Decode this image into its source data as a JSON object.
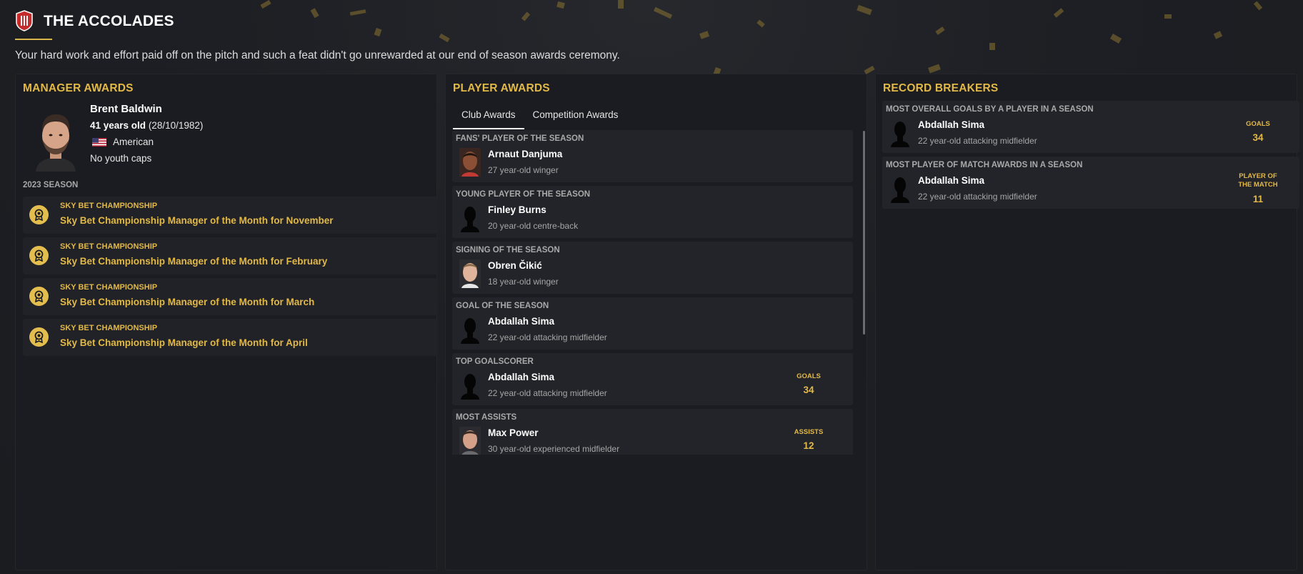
{
  "header": {
    "title": "THE ACCOLADES",
    "subtitle": "Your hard work and effort paid off on the pitch and such a feat didn't go unrewarded at our end of season awards ceremony."
  },
  "colors": {
    "accent": "#e2b847",
    "background": "#1c1e23",
    "card": "#22242a"
  },
  "manager_awards": {
    "title": "MANAGER AWARDS",
    "manager": {
      "name": "Brent Baldwin",
      "age_text": "41 years old",
      "dob": "(28/10/1982)",
      "nationality": "American",
      "youth_caps": "No youth caps",
      "flag_icon": "us-flag-icon"
    },
    "season_label": "2023 SEASON",
    "awards": [
      {
        "competition": "SKY BET CHAMPIONSHIP",
        "name": "Sky Bet Championship Manager of the Month for November",
        "icon": "award-medal-icon"
      },
      {
        "competition": "SKY BET CHAMPIONSHIP",
        "name": "Sky Bet Championship Manager of the Month for February",
        "icon": "award-medal-icon"
      },
      {
        "competition": "SKY BET CHAMPIONSHIP",
        "name": "Sky Bet Championship Manager of the Month for March",
        "icon": "award-medal-icon"
      },
      {
        "competition": "SKY BET CHAMPIONSHIP",
        "name": "Sky Bet Championship Manager of the Month for April",
        "icon": "award-medal-icon"
      }
    ]
  },
  "player_awards": {
    "title": "PLAYER AWARDS",
    "tabs": [
      {
        "label": "Club Awards",
        "active": true
      },
      {
        "label": "Competition Awards",
        "active": false
      }
    ],
    "items": [
      {
        "label": "FANS' PLAYER OF THE SEASON",
        "player": "Arnaut Danjuma",
        "desc": "27 year-old winger",
        "photo": "photo"
      },
      {
        "label": "YOUNG PLAYER OF THE SEASON",
        "player": "Finley Burns",
        "desc": "20 year-old centre-back",
        "photo": "silhouette"
      },
      {
        "label": "SIGNING OF THE SEASON",
        "player": "Obren Čikić",
        "desc": "18 year-old winger",
        "photo": "photo"
      },
      {
        "label": "GOAL OF THE SEASON",
        "player": "Abdallah Sima",
        "desc": "22 year-old attacking midfielder",
        "photo": "silhouette"
      },
      {
        "label": "TOP GOALSCORER",
        "player": "Abdallah Sima",
        "desc": "22 year-old attacking midfielder",
        "photo": "silhouette",
        "stat_label": "GOALS",
        "stat_value": "34"
      },
      {
        "label": "MOST ASSISTS",
        "player": "Max Power",
        "desc": "30 year-old experienced midfielder",
        "photo": "photo",
        "stat_label": "ASSISTS",
        "stat_value": "12"
      }
    ]
  },
  "record_breakers": {
    "title": "RECORD BREAKERS",
    "items": [
      {
        "label": "MOST OVERALL GOALS BY A PLAYER IN A SEASON",
        "player": "Abdallah Sima",
        "desc": "22 year-old attacking midfielder",
        "stat_label": "GOALS",
        "stat_value": "34"
      },
      {
        "label": "MOST PLAYER OF MATCH AWARDS IN A SEASON",
        "player": "Abdallah Sima",
        "desc": "22 year-old attacking midfielder",
        "stat_label": "PLAYER OF THE MATCH",
        "stat_value": "11"
      }
    ]
  }
}
